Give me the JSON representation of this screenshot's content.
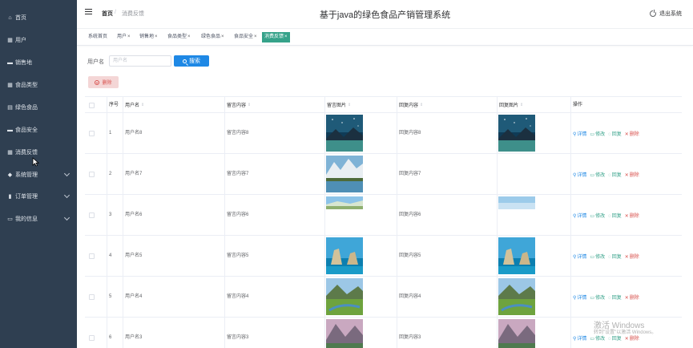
{
  "sidebar": {
    "items": [
      {
        "label": "首页",
        "icon": "home-icon",
        "glyph": "⌂",
        "has_children": false
      },
      {
        "label": "用户",
        "icon": "grid-icon",
        "glyph": "▦",
        "has_children": false
      },
      {
        "label": "销售地",
        "icon": "chat-icon",
        "glyph": "▬",
        "has_children": false
      },
      {
        "label": "食品类型",
        "icon": "grid-icon",
        "glyph": "▦",
        "has_children": false
      },
      {
        "label": "绿色食品",
        "icon": "doc-icon",
        "glyph": "▤",
        "has_children": false
      },
      {
        "label": "食品安全",
        "icon": "chat-icon",
        "glyph": "▬",
        "has_children": false
      },
      {
        "label": "消费反馈",
        "icon": "grid-icon",
        "glyph": "▦",
        "has_children": false
      },
      {
        "label": "系统管理",
        "icon": "location-icon",
        "glyph": "◆",
        "has_children": true
      },
      {
        "label": "订单管理",
        "icon": "chart-icon",
        "glyph": "▮",
        "has_children": true
      },
      {
        "label": "我的信息",
        "icon": "card-icon",
        "glyph": "▭",
        "has_children": true
      }
    ]
  },
  "header": {
    "breadcrumb_home": "首页",
    "breadcrumb_sep": "/",
    "breadcrumb_current": "消费反馈",
    "title": "基于java的绿色食品产销管理系统",
    "logout": "退出系统"
  },
  "tags": [
    {
      "label": "系统首页",
      "closable": false,
      "active": false
    },
    {
      "label": "用户",
      "closable": true,
      "active": false
    },
    {
      "label": "销售地",
      "closable": true,
      "active": false
    },
    {
      "label": "食品类型",
      "closable": true,
      "active": false
    },
    {
      "label": "绿色食品",
      "closable": true,
      "active": false
    },
    {
      "label": "食品安全",
      "closable": true,
      "active": false
    },
    {
      "label": "消费反馈",
      "closable": true,
      "active": true
    }
  ],
  "search": {
    "label": "用户名",
    "placeholder": "用户名",
    "value": "",
    "button": "搜索"
  },
  "delete_button": "删除",
  "table": {
    "columns": [
      "序号",
      "用户名",
      "留言内容",
      "留言图片",
      "回复内容",
      "回复图片",
      "操作"
    ],
    "rows": [
      {
        "index": "1",
        "username": "用户名8",
        "message": "留言内容8",
        "msg_img": "starry-lake",
        "reply": "回复内容8",
        "reply_img": "starry-lake"
      },
      {
        "index": "2",
        "username": "用户名7",
        "message": "留言内容7",
        "msg_img": "mountain-lake",
        "reply": "回复内容7",
        "reply_img": "none"
      },
      {
        "index": "3",
        "username": "用户名6",
        "message": "留言内容6",
        "msg_img": "snow-field-short",
        "reply": "回复内容6",
        "reply_img": "sky-short"
      },
      {
        "index": "4",
        "username": "用户名5",
        "message": "留言内容5",
        "msg_img": "sea-rocks",
        "reply": "回复内容5",
        "reply_img": "sea-rocks"
      },
      {
        "index": "5",
        "username": "用户名4",
        "message": "留言内容4",
        "msg_img": "green-valley",
        "reply": "回复内容4",
        "reply_img": "green-valley"
      },
      {
        "index": "6",
        "username": "用户名3",
        "message": "留言内容3",
        "msg_img": "pink-mountain",
        "reply": "回复内容3",
        "reply_img": "pink-mountain"
      }
    ],
    "actions": [
      "详情",
      "修改",
      "回复",
      "删除"
    ]
  },
  "watermark": {
    "line1": "激活 Windows",
    "line2": "转到\"设置\"以激活 Windows。"
  },
  "colors": {
    "sidebar_bg": "#2f3f51",
    "accent": "#36a28a",
    "primary": "#1e88e5",
    "danger": "#d9534f"
  }
}
